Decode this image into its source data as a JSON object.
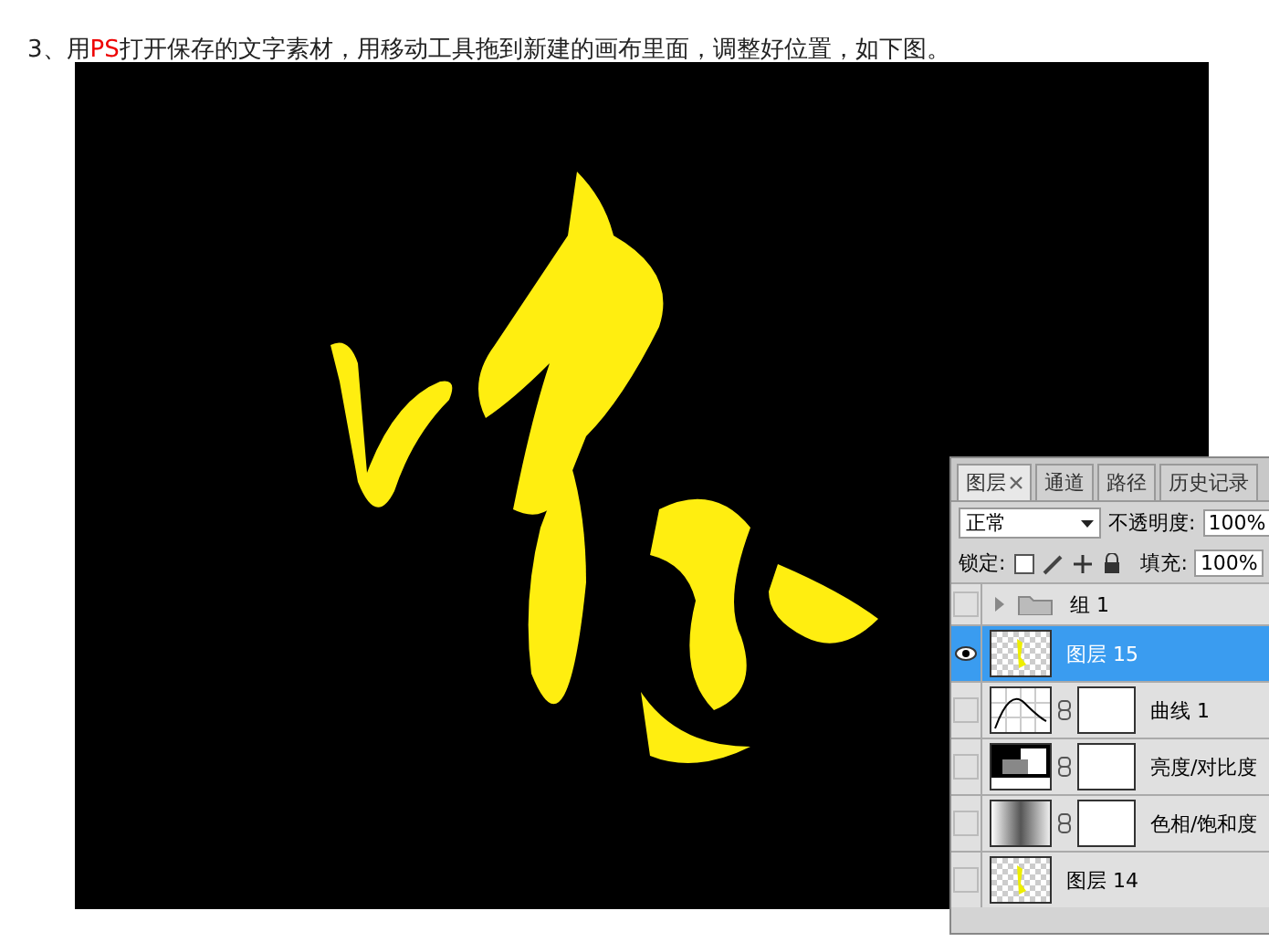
{
  "caption": [
    {
      "text": "3、用",
      "kind": "plain"
    },
    {
      "text": "PS",
      "kind": "highlight"
    },
    {
      "text": "打开保存的文字素材，用移动工具拖到新建的画布里面，调整好位置，如下图。",
      "kind": "plain"
    }
  ],
  "layers_panel": {
    "tabs": [
      {
        "label": "图层",
        "closable": true,
        "selected": true
      },
      {
        "label": "通道",
        "closable": false,
        "selected": false
      },
      {
        "label": "路径",
        "closable": false,
        "selected": false
      },
      {
        "label": "历史记录",
        "closable": false,
        "selected": false
      }
    ],
    "blend_mode": "正常",
    "opacity_label": "不透明度:",
    "opacity": "100%",
    "lock_label": "锁定:",
    "fill_label": "填充:",
    "fill": "100%",
    "layers": [
      {
        "name": "组 1",
        "kind": "group",
        "visible": false,
        "selected": false
      },
      {
        "name": "图层 15",
        "kind": "pixel",
        "visible": true,
        "selected": true
      },
      {
        "name": "曲线 1",
        "kind": "curves",
        "visible": false,
        "selected": false
      },
      {
        "name": "亮度/对比度",
        "kind": "levels",
        "visible": false,
        "selected": false
      },
      {
        "name": "色相/饱和度",
        "kind": "gradient",
        "visible": false,
        "selected": false
      },
      {
        "name": "图层 14",
        "kind": "pixel",
        "visible": false,
        "selected": false
      }
    ]
  }
}
